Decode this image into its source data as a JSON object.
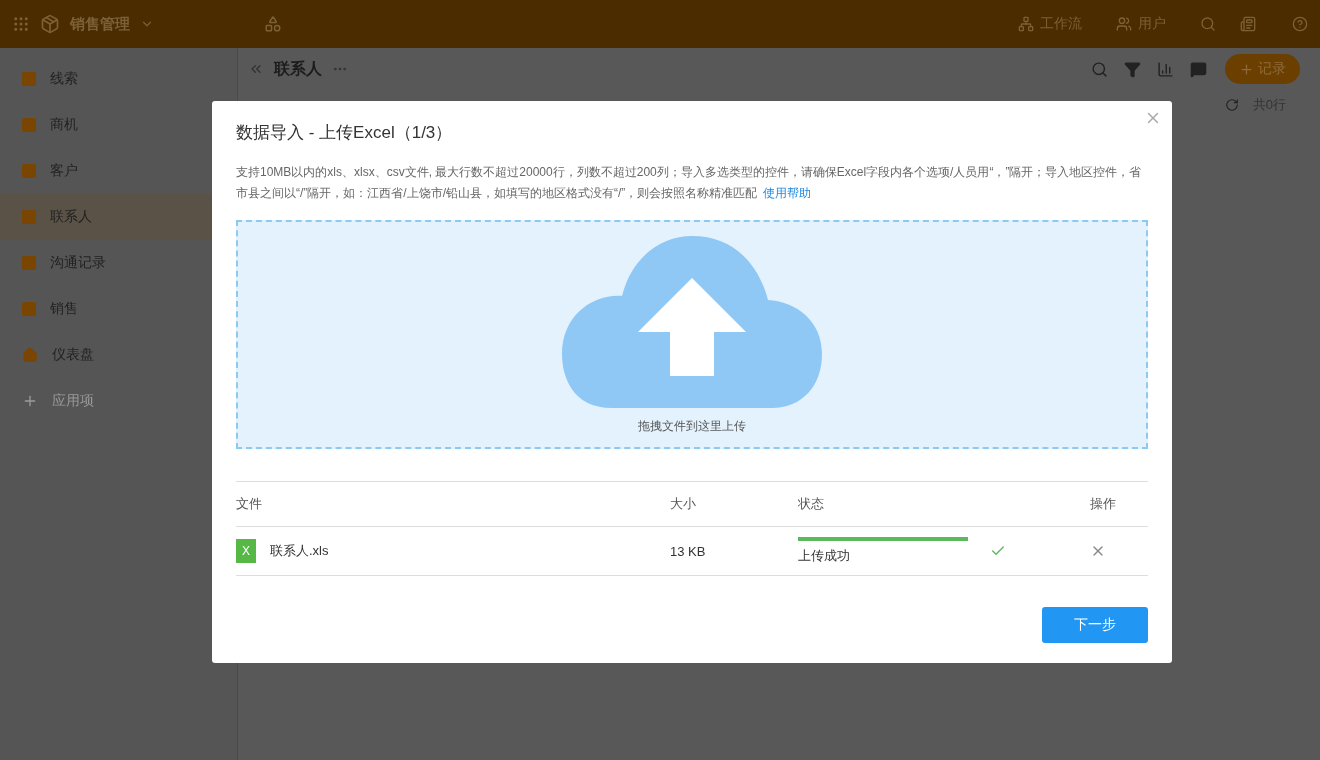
{
  "app": {
    "title": "销售管理",
    "nav": [
      {
        "label": "工作流"
      },
      {
        "label": "用户"
      }
    ]
  },
  "sidebar": {
    "items": [
      {
        "label": "线索",
        "kind": "table",
        "selected": false
      },
      {
        "label": "商机",
        "kind": "table",
        "selected": false
      },
      {
        "label": "客户",
        "kind": "table",
        "selected": false
      },
      {
        "label": "联系人",
        "kind": "table",
        "selected": true
      },
      {
        "label": "沟通记录",
        "kind": "table",
        "selected": false
      },
      {
        "label": "销售",
        "kind": "table",
        "selected": false
      },
      {
        "label": "仪表盘",
        "kind": "dashboard",
        "selected": false
      },
      {
        "label": "应用项",
        "kind": "add",
        "selected": false
      }
    ]
  },
  "page": {
    "title": "联系人",
    "add_button": "记录",
    "row_count": "共0行"
  },
  "dialog": {
    "title": "数据导入 - 上传Excel（1/3）",
    "description": "支持10MB以内的xls、xlsx、csv文件, 最大行数不超过20000行，列数不超过200列；导入多选类型的控件，请确保Excel字段内各个选项/人员用“，”隔开；导入地区控件，省市县之间以“/”隔开，如：江西省/上饶市/铅山县，如填写的地区格式没有“/”，则会按照名称精准匹配",
    "help_link": "使用帮助",
    "dropzone": "拖拽文件到这里上传",
    "columns": [
      "文件",
      "大小",
      "状态",
      "操作"
    ],
    "files": [
      {
        "name": "联系人.xls",
        "badge": "X",
        "size": "13 KB",
        "status": "上传成功",
        "level": 1,
        "done": true
      }
    ],
    "next_button": "下一步"
  }
}
